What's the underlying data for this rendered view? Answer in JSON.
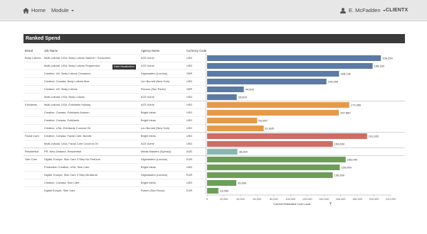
{
  "nav": {
    "home_label": "Home",
    "module_label": "Module",
    "user_name": "E. McFadden",
    "client_label": "CLIENTX"
  },
  "report": {
    "title": "Ranked Spend",
    "columns": {
      "brand": "Brand",
      "job": "Job Name",
      "agency": "Agency Name",
      "currency": "Currency Code"
    },
    "tooltip": "Data Visualization"
  },
  "chart_data": {
    "type": "bar",
    "orientation": "horizontal",
    "xlabel": "Current Estimated Cost Local",
    "xlim": [
      0,
      220000
    ],
    "xticks": [
      "0",
      "20,000",
      "40,000",
      "60,000",
      "80,000",
      "100,000",
      "120,000",
      "140,000",
      "160,000",
      "180,000",
      "200,000",
      "220,000"
    ],
    "grid": false,
    "colors": {
      "Body Lotions": "#5b7aa6",
      "Exfoliants": "#e59a4b",
      "Facial Care": "#cd6d66",
      "Residential": "#86b8b2",
      "Skin Care": "#6b9f57"
    },
    "rows": [
      {
        "brand": "Body Lotions",
        "job": "Multi-cultural, USA, Body Lotions Natural + Sunscreen",
        "agency": "ACE Acme",
        "currency": "USD",
        "value": 208254,
        "label": "208,254"
      },
      {
        "brand": "",
        "job": "Multi-cultural, USA, Body Lotions Peppermint",
        "agency": "ACE Acme",
        "currency": "USD",
        "value": 198332,
        "label": "198,332"
      },
      {
        "brand": "",
        "job": "Creative, UK, Body Lotions Cinnamon",
        "agency": "Digimasters (London)",
        "currency": "GBP",
        "value": 158130,
        "label": "158,130"
      },
      {
        "brand": "",
        "job": "Creative, Canada, Body Lotions Aloe",
        "agency": "Leo Burnett (New York)",
        "currency": "USD",
        "value": 143000,
        "label": "143,000"
      },
      {
        "brand": "",
        "job": "Creative, UK, Body Lotions",
        "agency": "Rococo (Sao Paulo)",
        "currency": "GBP",
        "value": 44000,
        "label": "44,000"
      },
      {
        "brand": "",
        "job": "Multi-cultural, USA, Body Lotions",
        "agency": "ACE Acme",
        "currency": "USD",
        "value": 35500,
        "label": "35,500"
      },
      {
        "brand": "Exfoliants",
        "job": "Multi-cultural, USA, Exfoliants Holiday",
        "agency": "ACE Acme",
        "currency": "USD",
        "value": 170356,
        "label": "170,356"
      },
      {
        "brand": "",
        "job": "Creative, Canada, Exfoliants Autumn",
        "agency": "Bright Ideas",
        "currency": "USD",
        "value": 157860,
        "label": "157,860"
      },
      {
        "brand": "",
        "job": "Creative, Canada, Exfoliants",
        "agency": "Bright Ideas",
        "currency": "USD",
        "value": 60000,
        "label": "60,000"
      },
      {
        "brand": "",
        "job": "Creative, USA, Exfoliants Coconut Oil",
        "agency": "Leo Burnett (New York)",
        "currency": "USD",
        "value": 67835,
        "label": "67,835"
      },
      {
        "brand": "Facial Care",
        "job": "Creative, Canada, Facial Care, Bundle",
        "agency": "Bright Ideas",
        "currency": "USD",
        "value": 191632,
        "label": "191,632"
      },
      {
        "brand": "",
        "job": "Multi-cultural, USA, Facial Care Coconut Oil",
        "agency": "ACE Acme",
        "currency": "USD",
        "value": 150600,
        "label": "150,600"
      },
      {
        "brand": "Residential",
        "job": "PR, New Zealand, Residential",
        "agency": "Media Masters (Sydney)",
        "currency": "AUD",
        "value": 36300,
        "label": "36,300"
      },
      {
        "brand": "Skin Care",
        "job": "Digital, Europe, Skin Care 3 Step No Perfume",
        "agency": "Digimasters (London)",
        "currency": "EUR",
        "value": 166040,
        "label": "166,040"
      },
      {
        "brand": "",
        "job": "Production Creative, USA, Skin Care",
        "agency": "Bright Ideas",
        "currency": "USD",
        "value": 159000,
        "label": "159,000"
      },
      {
        "brand": "",
        "job": "Digital, Europe, Skin Care 3 Step Medicinal",
        "agency": "Digimasters (London)",
        "currency": "EUR",
        "value": 150600,
        "label": "150,600"
      },
      {
        "brand": "",
        "job": "Creative, Canada, Skin Care",
        "agency": "Bright Ideas",
        "currency": "USD",
        "value": 35000,
        "label": "35,000"
      },
      {
        "brand": "",
        "job": "Digital Europe, Skin Care",
        "agency": "Rotom (Sao Paulo)",
        "currency": "EUR",
        "value": 13550,
        "label": "13,550"
      }
    ]
  }
}
